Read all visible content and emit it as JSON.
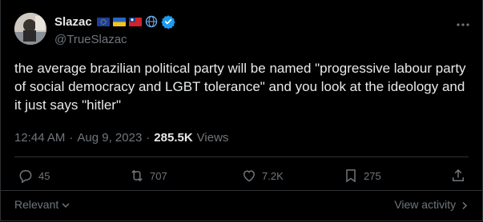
{
  "author": {
    "display_name": "Slazac",
    "handle": "@TrueSlazac",
    "verified": true,
    "badges": [
      "eu-flag-icon",
      "ukraine-flag-icon",
      "taiwan-flag-icon",
      "globe-icon"
    ]
  },
  "tweet": {
    "text": "the average brazilian political party will be named \"progressive labour party of social democracy and LGBT tolerance\" and you look at the ideology and it just says \"hitler\"",
    "time": "12:44 AM",
    "separator": "·",
    "date": "Aug 9, 2023",
    "views_count": "285.5K",
    "views_label": "Views"
  },
  "actions": {
    "replies": "45",
    "reposts": "707",
    "likes": "7.2K",
    "bookmarks": "275"
  },
  "footer": {
    "sort_label": "Relevant",
    "view_activity": "View activity"
  },
  "colors": {
    "background": "#000000",
    "text": "#e7e9ea",
    "muted": "#71767b",
    "verified": "#1d9bf0",
    "divider": "#2f3336"
  }
}
